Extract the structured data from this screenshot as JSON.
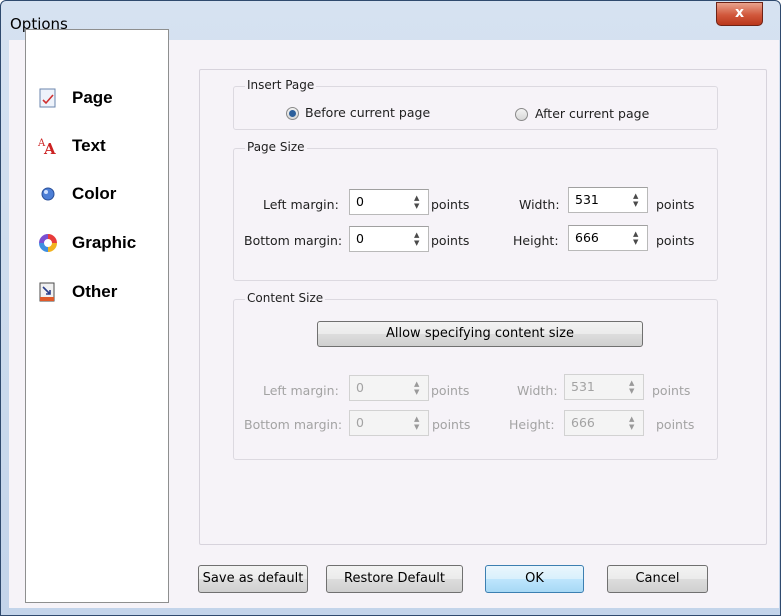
{
  "window": {
    "title": "Options",
    "close_glyph": "x"
  },
  "nav": {
    "items": [
      {
        "label": "Page",
        "icon": "page-icon"
      },
      {
        "label": "Text",
        "icon": "text-icon"
      },
      {
        "label": "Color",
        "icon": "color-icon"
      },
      {
        "label": "Graphic",
        "icon": "graphic-icon"
      },
      {
        "label": "Other",
        "icon": "other-icon"
      }
    ]
  },
  "insert_page": {
    "title": "Insert Page",
    "options": [
      {
        "label": "Before current page",
        "checked": true
      },
      {
        "label": "After current page",
        "checked": false
      }
    ]
  },
  "page_size": {
    "title": "Page Size",
    "left_margin": {
      "label": "Left margin:",
      "value": "0",
      "unit": "points"
    },
    "bottom_margin": {
      "label": "Bottom margin:",
      "value": "0",
      "unit": "points"
    },
    "width": {
      "label": "Width:",
      "value": "531",
      "unit": "points"
    },
    "height": {
      "label": "Height:",
      "value": "666",
      "unit": "points"
    }
  },
  "content_size": {
    "title": "Content Size",
    "allow_button": "Allow specifying content size",
    "left_margin": {
      "label": "Left margin:",
      "value": "0",
      "unit": "points"
    },
    "bottom_margin": {
      "label": "Bottom margin:",
      "value": "0",
      "unit": "points"
    },
    "width": {
      "label": "Width:",
      "value": "531",
      "unit": "points"
    },
    "height": {
      "label": "Height:",
      "value": "666",
      "unit": "points"
    }
  },
  "buttons": {
    "save_default": "Save as default",
    "restore_default": "Restore Default",
    "ok": "OK",
    "cancel": "Cancel"
  },
  "colors": {
    "accent": "#2c5f9c",
    "close": "#c9492d",
    "text_icon": "#cc2222"
  }
}
